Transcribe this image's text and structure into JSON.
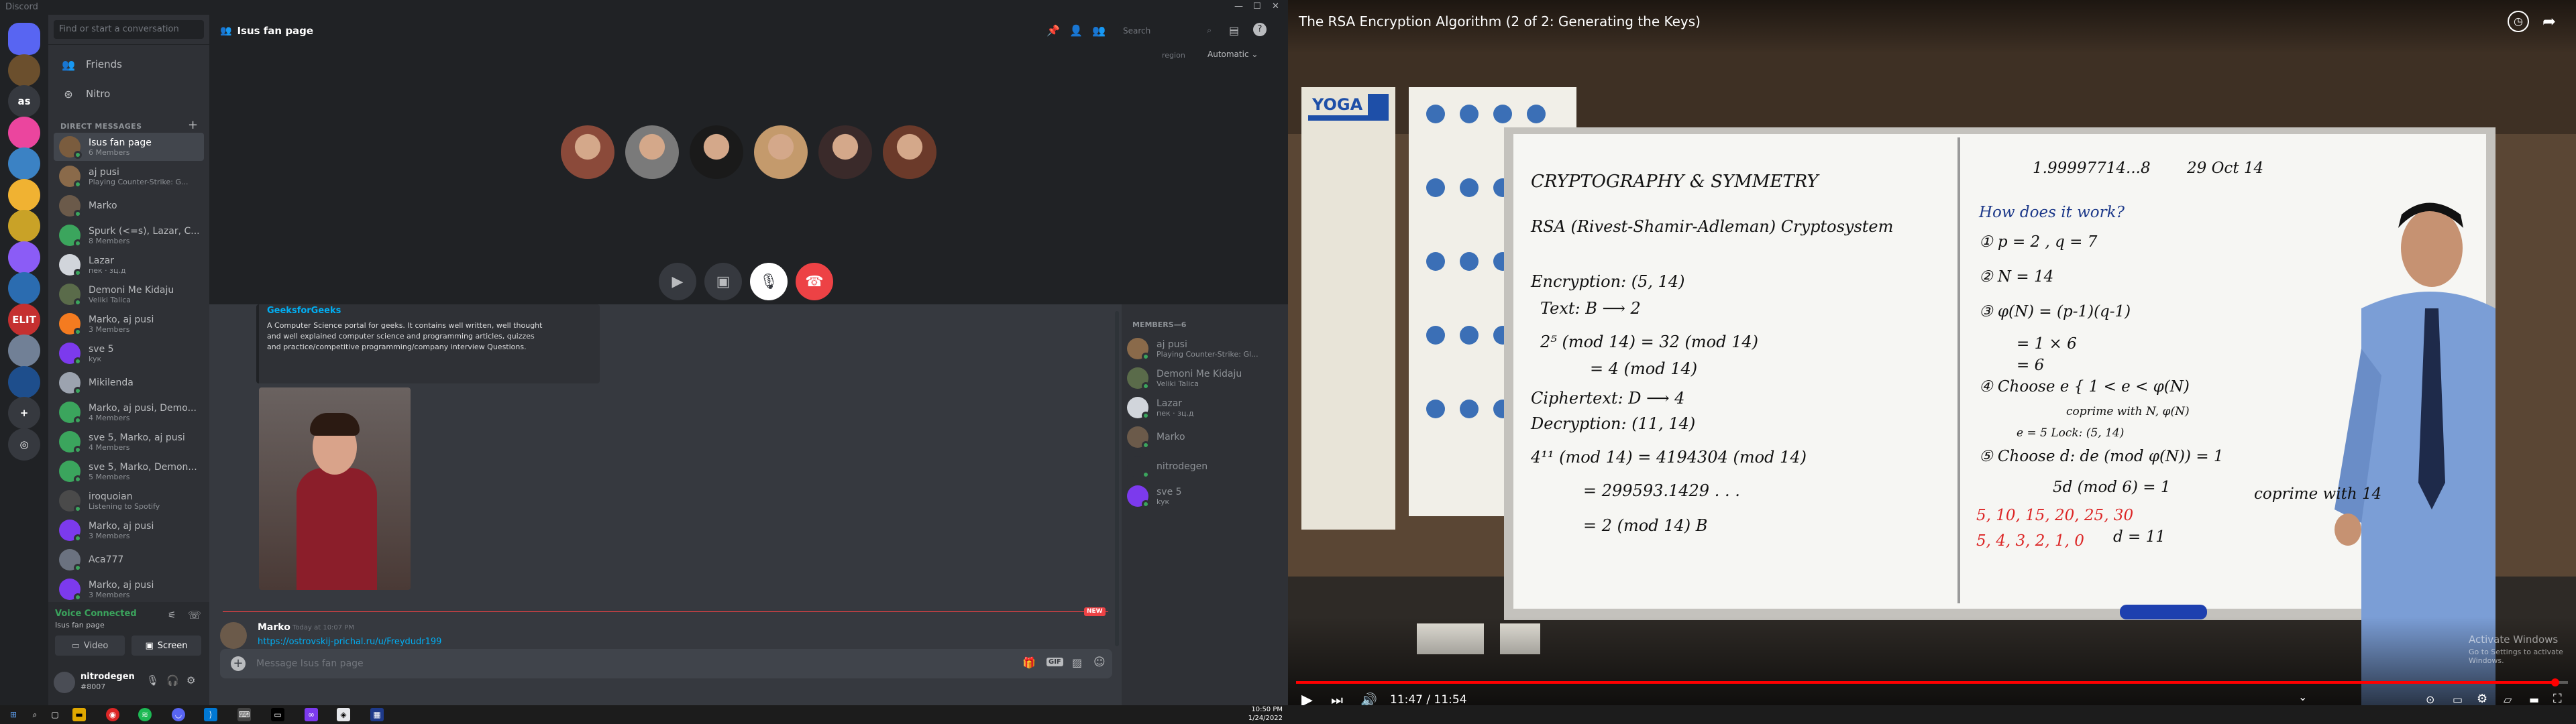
{
  "titlebar": {
    "title": "Discord"
  },
  "guilds": {
    "items": [
      {
        "label": "",
        "color": "#5865f2",
        "icon": "discord-logo",
        "badge": ""
      },
      {
        "label": "",
        "color": "#6b4f2d",
        "icon": "server-icon",
        "badge": ""
      },
      {
        "label": "as",
        "color": "#36393f",
        "icon": "",
        "badge": ""
      },
      {
        "label": "",
        "color": "#eb459e",
        "icon": "server-icon",
        "badge": ""
      },
      {
        "label": "",
        "color": "#3b82c4",
        "icon": "server-icon",
        "badge": "3"
      },
      {
        "label": "",
        "color": "#f0b232",
        "icon": "server-icon",
        "badge": ""
      },
      {
        "label": "",
        "color": "#c9a227",
        "icon": "server-icon",
        "badge": ""
      },
      {
        "label": "",
        "color": "#8b5cf6",
        "icon": "server-icon",
        "badge": ""
      },
      {
        "label": "",
        "color": "#2b6cb0",
        "icon": "server-icon",
        "badge": ""
      },
      {
        "label": "ELIT",
        "color": "#c53030",
        "icon": "",
        "badge": "1"
      },
      {
        "label": "",
        "color": "#718096",
        "icon": "server-icon",
        "badge": "1"
      },
      {
        "label": "",
        "color": "#1e4e8c",
        "icon": "server-icon",
        "badge": ""
      },
      {
        "label": "+",
        "color": "#36393f",
        "icon": "add-server-icon",
        "badge": ""
      },
      {
        "label": "◎",
        "color": "#36393f",
        "icon": "explore-icon",
        "badge": ""
      }
    ]
  },
  "dm": {
    "search_placeholder": "Find or start a conversation",
    "friends": "Friends",
    "nitro": "Nitro",
    "header": "DIRECT MESSAGES",
    "items": [
      {
        "name": "Isus fan page",
        "sub": "6 Members",
        "color": "#7a5c3e",
        "selected": true
      },
      {
        "name": "aj pusi",
        "sub": "Playing Counter-Strike: G...",
        "color": "#8a6a4a"
      },
      {
        "name": "Marko",
        "sub": "",
        "color": "#6b5a4a"
      },
      {
        "name": "Spurk (<=s), Lazar, C...",
        "sub": "8 Members",
        "color": "#3ba55d"
      },
      {
        "name": "Lazar",
        "sub": "пек · зц.д",
        "color": "#d1d5db"
      },
      {
        "name": "Demoni Me Kidaju",
        "sub": "Veliki Talica",
        "color": "#5a6b4a"
      },
      {
        "name": "Marko, aj pusi",
        "sub": "3 Members",
        "color": "#f47b20"
      },
      {
        "name": "sve 5",
        "sub": "kyк",
        "color": "#7c3aed"
      },
      {
        "name": "Mikilenda",
        "sub": "",
        "color": "#9ca3af"
      },
      {
        "name": "Marko, aj pusi, Demo...",
        "sub": "4 Members",
        "color": "#3ba55d"
      },
      {
        "name": "sve 5, Marko, aj pusi",
        "sub": "4 Members",
        "color": "#3ba55d"
      },
      {
        "name": "sve 5, Marko, Demon...",
        "sub": "5 Members",
        "color": "#3ba55d"
      },
      {
        "name": "iroquoian",
        "sub": "Listening to Spotify",
        "color": "#4a4a4a"
      },
      {
        "name": "Marko, aj pusi",
        "sub": "3 Members",
        "color": "#7c3aed"
      },
      {
        "name": "Aca777",
        "sub": "",
        "color": "#6b7280"
      },
      {
        "name": "Marko, aj pusi",
        "sub": "3 Members",
        "color": "#7c3aed"
      }
    ]
  },
  "voice": {
    "status": "Voice Connected",
    "channel": "Isus fan page",
    "video": "Video",
    "screen": "Screen"
  },
  "user": {
    "name": "nitrodegen",
    "tag": "#8007"
  },
  "channel": {
    "title": "Isus fan page",
    "search_placeholder": "Search",
    "region_label": "region",
    "region_value": "Automatic"
  },
  "call": {
    "participants": [
      {
        "color": "#8b4a3a"
      },
      {
        "color": "#7a7a7a"
      },
      {
        "color": "#1a1a1a"
      },
      {
        "color": "#c49a6c"
      },
      {
        "color": "#3a2a2a"
      },
      {
        "color": "#6b3a2a"
      }
    ]
  },
  "embed": {
    "title": "GeeksforGeeks",
    "description": "A Computer Science portal for geeks. It contains well written, well thought and well explained computer science and programming articles, quizzes and practice/competitive programming/company interview Questions."
  },
  "message": {
    "author": "Marko",
    "time": "Today at 10:07 PM",
    "link": "https://ostrovskij-prichal.ru/u/Freydudr199",
    "new_badge": "NEW"
  },
  "composer": {
    "placeholder": "Message Isus fan page"
  },
  "members": {
    "header": "MEMBERS—6",
    "items": [
      {
        "name": "aj pusi",
        "sub": "Playing Counter-Strike: Gl...",
        "color": "#8a6a4a"
      },
      {
        "name": "Demoni Me Kidaju",
        "sub": "Veliki Talica",
        "color": "#5a6b4a"
      },
      {
        "name": "Lazar",
        "sub": "пек · зц.д",
        "color": "#d1d5db"
      },
      {
        "name": "Marko",
        "sub": "",
        "color": "#6b5a4a"
      },
      {
        "name": "nitrodegen",
        "sub": "",
        "color": "#2f3136"
      },
      {
        "name": "sve 5",
        "sub": "kyк",
        "color": "#7c3aed"
      }
    ]
  },
  "taskbar": {
    "time": "10:50 PM",
    "date": "1/24/2022"
  },
  "youtube": {
    "title": "The RSA Encryption Algorithm (2 of 2: Generating the Keys)",
    "time": "11:47 / 11:54",
    "progress": 0.99,
    "watermark1": "Activate Windows",
    "watermark2": "Go to Settings to activate Windows.",
    "poster": "YOGA"
  },
  "board": {
    "left": [
      {
        "text": "CRYPTOGRAPHY  &  SYMMETRY",
        "color": "#111"
      },
      {
        "text": "RSA (Rivest-Shamir-Adleman) Cryptosystem",
        "color": "#111"
      },
      {
        "text": "Encryption: (5, 14)",
        "color": "#111"
      },
      {
        "text": "Text:  B ⟶ 2",
        "color": "#111"
      },
      {
        "text": "2⁵ (mod 14) = 32 (mod 14)",
        "color": "#111"
      },
      {
        "text": "= 4 (mod 14)",
        "color": "#111"
      },
      {
        "text": "Ciphertext:  D ⟶ 4",
        "color": "#111"
      },
      {
        "text": "Decryption: (11, 14)",
        "color": "#111"
      },
      {
        "text": "4¹¹ (mod 14) = 4194304 (mod 14)",
        "color": "#111"
      },
      {
        "text": "= 299593.1429 . . .",
        "color": "#111"
      },
      {
        "text": "= 2 (mod 14)   B",
        "color": "#111"
      }
    ],
    "right": [
      {
        "text": "1.99997714...8",
        "color": "#111"
      },
      {
        "text": "29 Oct 14",
        "color": "#111"
      },
      {
        "text": "How does it work?",
        "color": "#1e3a8a"
      },
      {
        "text": "① p = 2 ,   q = 7",
        "color": "#111"
      },
      {
        "text": "② N = 14",
        "color": "#111"
      },
      {
        "text": "③ φ(N) = (p-1)(q-1)",
        "color": "#111"
      },
      {
        "text": "= 1 × 6",
        "color": "#111"
      },
      {
        "text": "= 6",
        "color": "#111"
      },
      {
        "text": "④ Choose e { 1 < e < φ(N)",
        "color": "#111"
      },
      {
        "text": "coprime with N, φ(N)",
        "color": "#111"
      },
      {
        "text": "e = 5      Lock: (5, 14)",
        "color": "#111"
      },
      {
        "text": "⑤ Choose d: de (mod φ(N)) = 1",
        "color": "#111"
      },
      {
        "text": "5d (mod 6) = 1",
        "color": "#111"
      },
      {
        "text": "5, 10, 15, 20, 25, 30",
        "color": "#dc2626"
      },
      {
        "text": "5, 4, 3, 2, 1, 0",
        "color": "#dc2626"
      },
      {
        "text": "d = 11",
        "color": "#111"
      },
      {
        "text": "coprime with 14",
        "color": "#111"
      }
    ]
  }
}
